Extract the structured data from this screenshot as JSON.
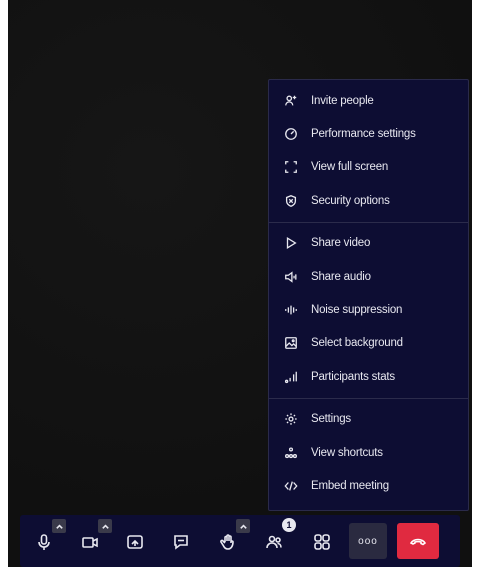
{
  "menu": {
    "groups": [
      {
        "items": [
          {
            "label": "Invite people",
            "icon": "add-person-icon"
          },
          {
            "label": "Performance settings",
            "icon": "gauge-icon"
          },
          {
            "label": "View full screen",
            "icon": "fullscreen-icon"
          },
          {
            "label": "Security options",
            "icon": "shield-icon"
          }
        ]
      },
      {
        "items": [
          {
            "label": "Share video",
            "icon": "play-icon"
          },
          {
            "label": "Share audio",
            "icon": "speaker-icon"
          },
          {
            "label": "Noise suppression",
            "icon": "noise-icon"
          },
          {
            "label": "Select background",
            "icon": "image-icon"
          },
          {
            "label": "Participants stats",
            "icon": "stats-icon"
          }
        ]
      },
      {
        "items": [
          {
            "label": "Settings",
            "icon": "gear-icon"
          },
          {
            "label": "View shortcuts",
            "icon": "shortcuts-icon"
          },
          {
            "label": "Embed meeting",
            "icon": "code-icon"
          }
        ]
      }
    ]
  },
  "toolbar": {
    "participants_badge": "1",
    "more_label": "ooo",
    "colors": {
      "background": "#0d0d33",
      "hangup": "#e02a40"
    }
  }
}
